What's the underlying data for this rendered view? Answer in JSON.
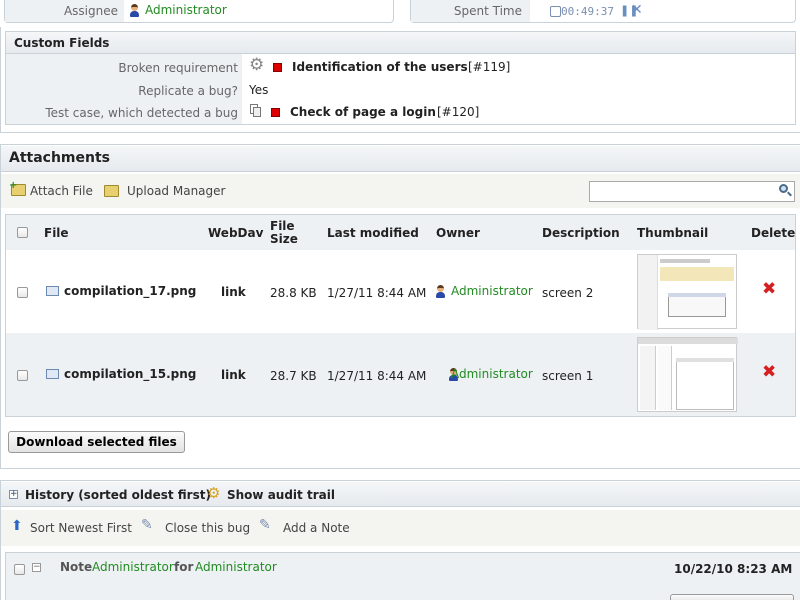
{
  "top": {
    "assignee_label": "Assignee",
    "assignee_value": "Administrator",
    "spent_time_label": "Spent Time",
    "spent_time_value": "00:49:37"
  },
  "custom_fields": {
    "title": "Custom Fields",
    "rows": [
      {
        "label": "Broken requirement",
        "value": "Identification of the users",
        "ref": "[#119]"
      },
      {
        "label": "Replicate a bug?",
        "value": "Yes"
      },
      {
        "label": "Test case, which detected a bug",
        "value": "Check of page a login",
        "ref": "[#120]"
      }
    ]
  },
  "attachments": {
    "title": "Attachments",
    "attach_file": "Attach File",
    "upload_manager": "Upload Manager",
    "search_placeholder": "",
    "columns": [
      "File",
      "WebDav",
      "File Size",
      "Last modified",
      "Owner",
      "Description",
      "Thumbnail",
      "Delete"
    ],
    "rows": [
      {
        "file": "compilation_17.png",
        "webdav": "link",
        "size": "28.8 KB",
        "modified": "1/27/11 8:44 AM",
        "owner": "Administrator",
        "description": "screen 2"
      },
      {
        "file": "compilation_15.png",
        "webdav": "link",
        "size": "28.7 KB",
        "modified": "1/27/11 8:44 AM",
        "owner": "Administrator",
        "description": "screen 1"
      }
    ],
    "download_button": "Download selected files"
  },
  "history": {
    "title": "History (sorted oldest first)",
    "audit": "Show audit trail",
    "sort_newest": "Sort Newest First",
    "close_bug": "Close this bug",
    "add_note": "Add a Note",
    "note_label": "Note",
    "note_author": "Administrator",
    "note_for": "for",
    "note_target": "Administrator",
    "note_date": "10/22/10 8:23 AM"
  },
  "colors": {
    "accent_green": "#228b22",
    "delete_red": "#d42020",
    "section_border": "#c9d1d9"
  }
}
